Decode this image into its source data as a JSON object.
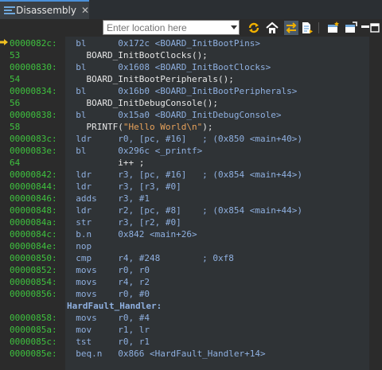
{
  "tab": {
    "label": "Disassembly",
    "close": "✕"
  },
  "toolbar": {
    "location_placeholder": "Enter location here"
  },
  "icons": {
    "tab": "disassembly-icon",
    "refresh": "refresh-icon",
    "home": "home-icon",
    "link": "link-with-editor-icon",
    "source": "show-source-icon",
    "newview": "open-new-view-icon",
    "pin": "pin-icon",
    "min": "minimize-icon",
    "max": "maximize-icon"
  },
  "colors": {
    "address": "#3fc13f",
    "instruction": "#8fb0e0",
    "source": "#e6e6e6",
    "string": "#e8a25a",
    "pc_marker": "#f0c020"
  },
  "lines": [
    {
      "gutter": "0000082c:",
      "type": "instr",
      "text": "  bl      0x172c <BOARD_InitBootPins>"
    },
    {
      "gutter": "53",
      "type": "src",
      "text": "    BOARD_InitBootClocks();"
    },
    {
      "gutter": "00000830:",
      "type": "instr",
      "text": "  bl      0x1608 <BOARD_InitBootClocks>"
    },
    {
      "gutter": "54",
      "type": "src",
      "text": "    BOARD_InitBootPeripherals();"
    },
    {
      "gutter": "00000834:",
      "type": "instr",
      "text": "  bl      0x16b0 <BOARD_InitBootPeripherals>"
    },
    {
      "gutter": "56",
      "type": "src",
      "text": "    BOARD_InitDebugConsole();"
    },
    {
      "gutter": "00000838:",
      "type": "instr",
      "text": "  bl      0x15a0 <BOARD_InitDebugConsole>"
    },
    {
      "gutter": "58",
      "type": "printf",
      "pre": "    PRINTF(",
      "str": "\"Hello World\\n\"",
      "post": ");"
    },
    {
      "gutter": "0000083c:",
      "type": "instr",
      "text": "  ldr     r0, [pc, #16]   ; (0x850 <main+40>)"
    },
    {
      "gutter": "0000083e:",
      "type": "instr",
      "text": "  bl      0x296c <_printf>"
    },
    {
      "gutter": "64",
      "type": "src",
      "text": "          i++ ;"
    },
    {
      "gutter": "00000842:",
      "type": "instr",
      "text": "  ldr     r3, [pc, #16]   ; (0x854 <main+44>)"
    },
    {
      "gutter": "00000844:",
      "type": "instr",
      "text": "  ldr     r3, [r3, #0]"
    },
    {
      "gutter": "00000846:",
      "type": "instr",
      "text": "  adds    r3, #1"
    },
    {
      "gutter": "00000848:",
      "type": "instr",
      "text": "  ldr     r2, [pc, #8]    ; (0x854 <main+44>)"
    },
    {
      "gutter": "0000084a:",
      "type": "instr",
      "text": "  str     r3, [r2, #0]"
    },
    {
      "gutter": "0000084c:",
      "type": "instr",
      "text": "  b.n     0x842 <main+26>"
    },
    {
      "gutter": "0000084e:",
      "type": "instr",
      "text": "  nop"
    },
    {
      "gutter": "00000850:",
      "type": "instr",
      "text": "  cmp     r4, #248        ; 0xf8"
    },
    {
      "gutter": "00000852:",
      "type": "instr",
      "text": "  movs    r0, r0"
    },
    {
      "gutter": "00000854:",
      "type": "instr",
      "text": "  movs    r4, r2"
    },
    {
      "gutter": "00000856:",
      "type": "instr",
      "text": "  movs    r0, #0"
    },
    {
      "gutter": "",
      "type": "label",
      "text": "HardFault_Handler:"
    },
    {
      "gutter": "00000858:",
      "type": "instr",
      "text": "  movs    r0, #4"
    },
    {
      "gutter": "0000085a:",
      "type": "instr",
      "text": "  mov     r1, lr"
    },
    {
      "gutter": "0000085c:",
      "type": "instr",
      "text": "  tst     r0, r1"
    },
    {
      "gutter": "0000085e:",
      "type": "instr",
      "text": "  beq.n   0x866 <HardFault_Handler+14>"
    }
  ]
}
